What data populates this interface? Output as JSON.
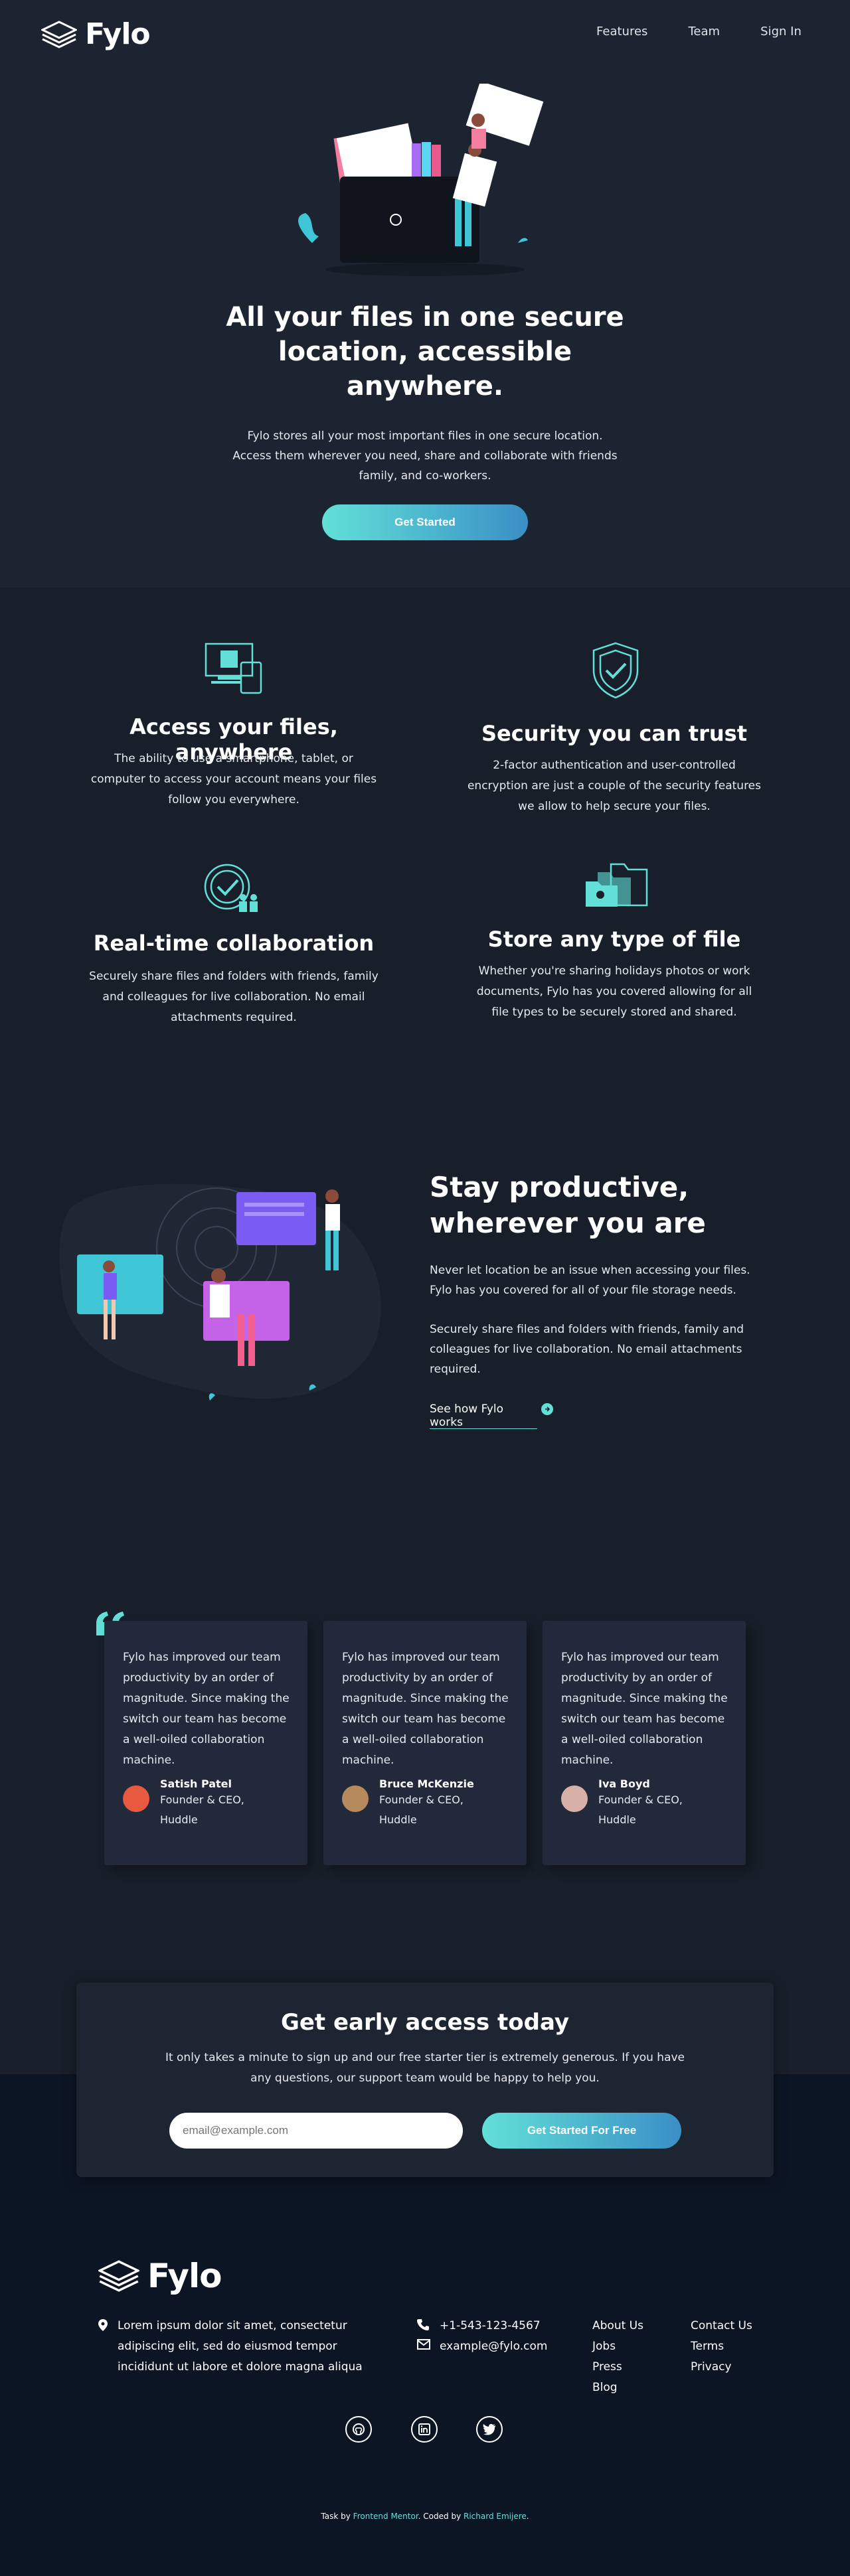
{
  "header": {
    "logo_text": "Fylo",
    "nav": [
      "Features",
      "Team",
      "Sign In"
    ]
  },
  "hero": {
    "title_lines": [
      "All your files in one secure",
      "location, accessible",
      "anywhere."
    ],
    "subtitle_lines": [
      "Fylo stores all your most important files in one secure location.",
      "Access them wherever you need, share and collaborate with friends",
      "family, and co-workers."
    ],
    "cta_label": "Get Started"
  },
  "features": [
    {
      "title": "Access your files, anywhere",
      "lines": [
        "The ability to use a smartphone, tablet, or",
        "computer to access your account means your files",
        "follow you everywhere."
      ],
      "icon": "devices-icon"
    },
    {
      "title": "Security you can trust",
      "lines": [
        "2-factor authentication and user-controlled",
        "encryption are just a couple of the security features",
        "we allow to help secure your files."
      ],
      "icon": "shield-check-icon"
    },
    {
      "title": "Real-time collaboration",
      "lines": [
        "Securely share files and folders with friends, family",
        "and colleagues for live collaboration. No email",
        "attachments required."
      ],
      "icon": "collaboration-icon"
    },
    {
      "title": "Store any type of file",
      "lines": [
        "Whether you're sharing holidays photos or work",
        "documents, Fylo has you covered allowing for all",
        "file types to be securely stored and shared."
      ],
      "icon": "folders-icon"
    }
  ],
  "productive": {
    "title_lines": [
      "Stay productive,",
      "wherever you are"
    ],
    "para1_lines": [
      "Never let location be an issue when accessing your files.",
      "Fylo has you covered for all of your file storage needs."
    ],
    "para2_lines": [
      "Securely share files and folders with friends, family and",
      "colleagues for live collaboration. No email attachments",
      "required."
    ],
    "link_label": "See how Fylo works"
  },
  "testimonials": [
    {
      "quote_lines": [
        "Fylo has improved our team",
        "productivity by an order of",
        "magnitude. Since making the",
        "switch our team has become",
        "a well-oiled collaboration",
        "machine."
      ],
      "name": "Satish Patel",
      "role_lines": [
        "Founder & CEO,",
        "Huddle"
      ]
    },
    {
      "quote_lines": [
        "Fylo has improved our team",
        "productivity by an order of",
        "magnitude. Since making the",
        "switch our team has become",
        "a well-oiled collaboration",
        "machine."
      ],
      "name": "Bruce McKenzie",
      "role_lines": [
        "Founder & CEO,",
        "Huddle"
      ]
    },
    {
      "quote_lines": [
        "Fylo has improved our team",
        "productivity by an order of",
        "magnitude. Since making the",
        "switch our team has become",
        "a well-oiled collaboration",
        "machine."
      ],
      "name": "Iva Boyd",
      "role_lines": [
        "Founder & CEO,",
        "Huddle"
      ]
    }
  ],
  "cta": {
    "title": "Get early access today",
    "text_lines": [
      "It only takes a minute to sign up and our free starter tier is extremely generous. If you have",
      "any questions, our support team would be happy to help you."
    ],
    "email_placeholder": "email@example.com",
    "button_label": "Get Started For Free"
  },
  "footer": {
    "logo_text": "Fylo",
    "address_lines": [
      "Lorem ipsum dolor sit amet, consectetur",
      "adipiscing elit, sed do eiusmod tempor",
      "incididunt ut labore et dolore magna aliqua"
    ],
    "phone": "+1-543-123-4567",
    "email": "example@fylo.com",
    "links_col1": [
      "About Us",
      "Jobs",
      "Press",
      "Blog"
    ],
    "links_col2": [
      "Contact Us",
      "Terms",
      "Privacy"
    ],
    "attribution_prefix": "Task by",
    "attribution_mentor": "Frontend Mentor",
    "attribution_mid": ". Coded by",
    "attribution_author": "Richard Emijere",
    "attribution_suffix": "."
  },
  "colors": {
    "accent_teal": "#62e0d8",
    "accent_blue": "#3a8fc6",
    "bg_dark": "#181f2a",
    "footer_bg": "#0c1524",
    "card_bg": "#21293a"
  }
}
